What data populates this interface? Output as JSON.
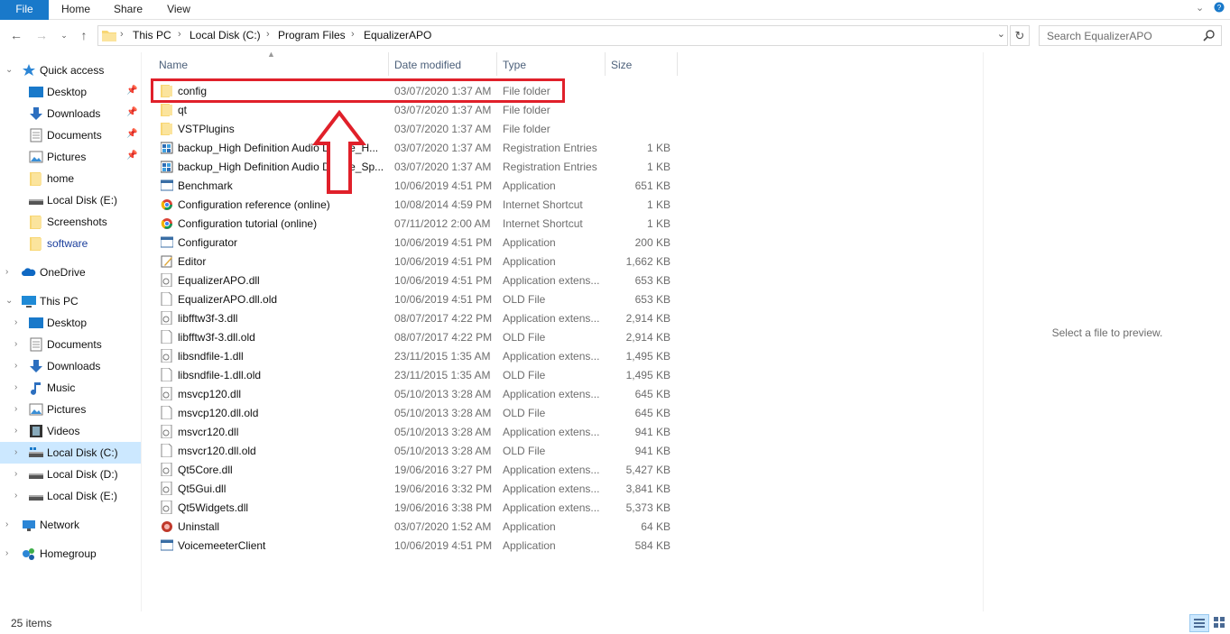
{
  "ribbon": {
    "tabs": [
      "File",
      "Home",
      "Share",
      "View"
    ],
    "expand_icon": "chevron-down-icon",
    "help_icon": "help-icon"
  },
  "address": {
    "crumbs": [
      "This PC",
      "Local Disk (C:)",
      "Program Files",
      "EqualizerAPO"
    ]
  },
  "search": {
    "placeholder": "Search EqualizerAPO"
  },
  "nav": {
    "quick_access": "Quick access",
    "quick_items": [
      "Desktop",
      "Downloads",
      "Documents",
      "Pictures",
      "home",
      "Local Disk (E:)",
      "Screenshots",
      "software"
    ],
    "onedrive": "OneDrive",
    "this_pc": "This PC",
    "pc_items": [
      "Desktop",
      "Documents",
      "Downloads",
      "Music",
      "Pictures",
      "Videos",
      "Local Disk (C:)",
      "Local Disk (D:)",
      "Local Disk (E:)"
    ],
    "network": "Network",
    "homegroup": "Homegroup"
  },
  "columns": {
    "name": "Name",
    "date": "Date modified",
    "type": "Type",
    "size": "Size"
  },
  "files": [
    {
      "name": "config",
      "date": "03/07/2020 1:37 AM",
      "type": "File folder",
      "size": "",
      "icon": "folder"
    },
    {
      "name": "qt",
      "date": "03/07/2020 1:37 AM",
      "type": "File folder",
      "size": "",
      "icon": "folder"
    },
    {
      "name": "VSTPlugins",
      "date": "03/07/2020 1:37 AM",
      "type": "File folder",
      "size": "",
      "icon": "folder"
    },
    {
      "name": "backup_High Definition Audio Device_H...",
      "date": "03/07/2020 1:37 AM",
      "type": "Registration Entries",
      "size": "1 KB",
      "icon": "reg"
    },
    {
      "name": "backup_High Definition Audio Device_Sp...",
      "date": "03/07/2020 1:37 AM",
      "type": "Registration Entries",
      "size": "1 KB",
      "icon": "reg"
    },
    {
      "name": "Benchmark",
      "date": "10/06/2019 4:51 PM",
      "type": "Application",
      "size": "651 KB",
      "icon": "app"
    },
    {
      "name": "Configuration reference (online)",
      "date": "10/08/2014 4:59 PM",
      "type": "Internet Shortcut",
      "size": "1 KB",
      "icon": "web"
    },
    {
      "name": "Configuration tutorial (online)",
      "date": "07/11/2012 2:00 AM",
      "type": "Internet Shortcut",
      "size": "1 KB",
      "icon": "web"
    },
    {
      "name": "Configurator",
      "date": "10/06/2019 4:51 PM",
      "type": "Application",
      "size": "200 KB",
      "icon": "app"
    },
    {
      "name": "Editor",
      "date": "10/06/2019 4:51 PM",
      "type": "Application",
      "size": "1,662 KB",
      "icon": "editor"
    },
    {
      "name": "EqualizerAPO.dll",
      "date": "10/06/2019 4:51 PM",
      "type": "Application extens...",
      "size": "653 KB",
      "icon": "dll"
    },
    {
      "name": "EqualizerAPO.dll.old",
      "date": "10/06/2019 4:51 PM",
      "type": "OLD File",
      "size": "653 KB",
      "icon": "file"
    },
    {
      "name": "libfftw3f-3.dll",
      "date": "08/07/2017 4:22 PM",
      "type": "Application extens...",
      "size": "2,914 KB",
      "icon": "dll"
    },
    {
      "name": "libfftw3f-3.dll.old",
      "date": "08/07/2017 4:22 PM",
      "type": "OLD File",
      "size": "2,914 KB",
      "icon": "file"
    },
    {
      "name": "libsndfile-1.dll",
      "date": "23/11/2015 1:35 AM",
      "type": "Application extens...",
      "size": "1,495 KB",
      "icon": "dll"
    },
    {
      "name": "libsndfile-1.dll.old",
      "date": "23/11/2015 1:35 AM",
      "type": "OLD File",
      "size": "1,495 KB",
      "icon": "file"
    },
    {
      "name": "msvcp120.dll",
      "date": "05/10/2013 3:28 AM",
      "type": "Application extens...",
      "size": "645 KB",
      "icon": "dll"
    },
    {
      "name": "msvcp120.dll.old",
      "date": "05/10/2013 3:28 AM",
      "type": "OLD File",
      "size": "645 KB",
      "icon": "file"
    },
    {
      "name": "msvcr120.dll",
      "date": "05/10/2013 3:28 AM",
      "type": "Application extens...",
      "size": "941 KB",
      "icon": "dll"
    },
    {
      "name": "msvcr120.dll.old",
      "date": "05/10/2013 3:28 AM",
      "type": "OLD File",
      "size": "941 KB",
      "icon": "file"
    },
    {
      "name": "Qt5Core.dll",
      "date": "19/06/2016 3:27 PM",
      "type": "Application extens...",
      "size": "5,427 KB",
      "icon": "dll"
    },
    {
      "name": "Qt5Gui.dll",
      "date": "19/06/2016 3:32 PM",
      "type": "Application extens...",
      "size": "3,841 KB",
      "icon": "dll"
    },
    {
      "name": "Qt5Widgets.dll",
      "date": "19/06/2016 3:38 PM",
      "type": "Application extens...",
      "size": "5,373 KB",
      "icon": "dll"
    },
    {
      "name": "Uninstall",
      "date": "03/07/2020 1:52 AM",
      "type": "Application",
      "size": "64 KB",
      "icon": "uninstall"
    },
    {
      "name": "VoicemeeterClient",
      "date": "10/06/2019 4:51 PM",
      "type": "Application",
      "size": "584 KB",
      "icon": "app"
    }
  ],
  "preview": {
    "message": "Select a file to preview."
  },
  "status": {
    "items": "25 items"
  },
  "colors": {
    "accent": "#1979ca",
    "selection": "#cce8ff",
    "annotation": "#e0202a",
    "folder": "#f8d775"
  }
}
